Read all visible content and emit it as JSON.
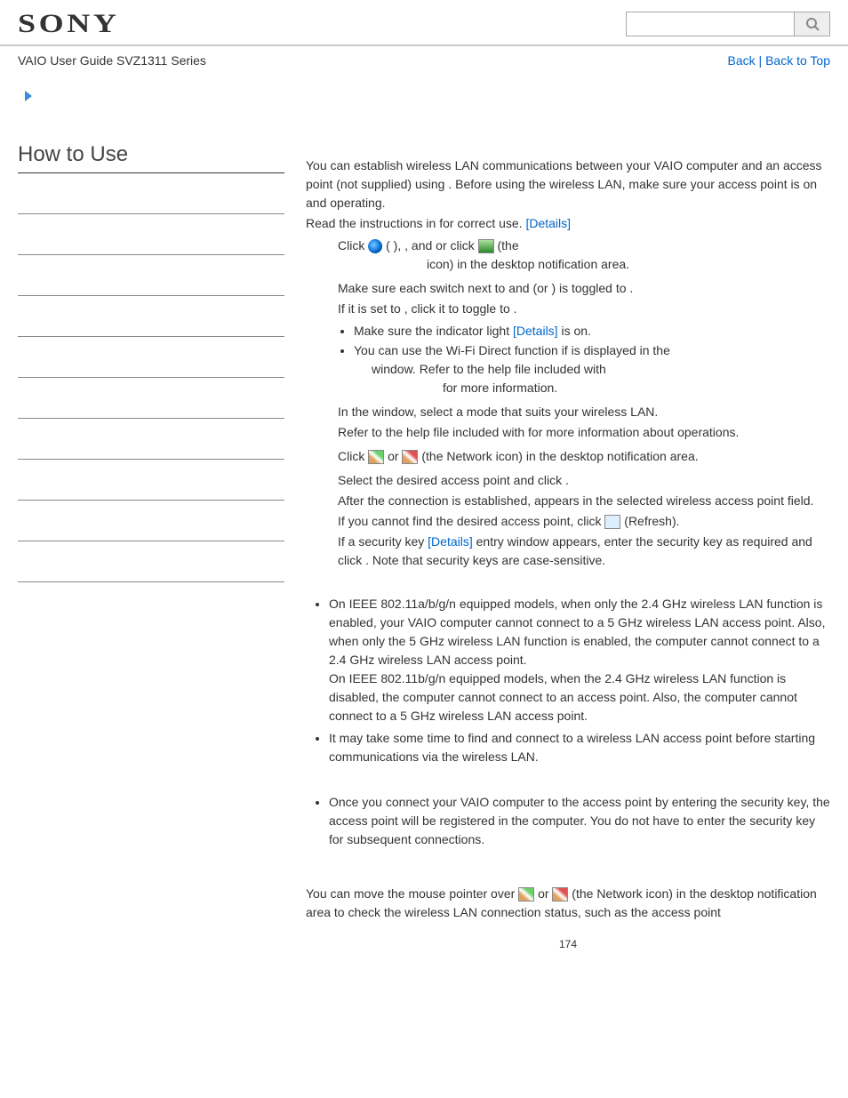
{
  "header": {
    "logo": "SONY",
    "subtitle": "VAIO User Guide SVZ1311 Series",
    "back": "Back",
    "back_to_top": "Back to Top",
    "sep": " | "
  },
  "sidebar": {
    "title": "How to Use"
  },
  "body": {
    "intro1a": "You can establish wireless LAN communications between your VAIO computer and an access point (not supplied) using ",
    "intro1b": ". Before using the wireless LAN, make sure your access point is on and operating.",
    "intro2a": "Read the instructions in ",
    "intro2b": " for correct use. ",
    "details": "[Details]",
    "s1a": "Click ",
    "s1b": " (      ), ",
    "s1c": ", and ",
    "s1d": " or click ",
    "s1e": " (the ",
    "s1f": " icon) in the desktop notification area.",
    "s2a": "Make sure each switch next to ",
    "s2b": " and ",
    "s2c": " (or          ) is toggled to      .",
    "s2d": "If it is set to      , click it to toggle to      .",
    "s2h1a": "Make sure the ",
    "s2h1b": " indicator light ",
    "s2h1c": " is on.",
    "s2h2a": "You can use the Wi-Fi Direct function if ",
    "s2h2b": " is displayed in the ",
    "s2h2c": " window. Refer to the help file included with ",
    "s2h2d": " for more information.",
    "s3a": "In the ",
    "s3b": " window, select a mode that suits your wireless LAN.",
    "s3c": "Refer to the help file included with ",
    "s3d": " for more information about operations.",
    "s4a": "Click ",
    "s4b": " or ",
    "s4c": " (the Network icon) in the desktop notification area.",
    "s5a": "Select the desired access point and click ",
    "s5b": ".",
    "s5c": "After the connection is established, ",
    "s5d": " appears in the selected wireless access point field.",
    "s5e": "If you cannot find the desired access point, click ",
    "s5f": " (Refresh).",
    "s5g": "If a security key ",
    "s5h": " entry window appears, enter the security key as required and click ",
    "s5i": ". Note that security keys are case-sensitive.",
    "note1": "On IEEE 802.11a/b/g/n equipped models, when only the 2.4 GHz wireless LAN function is enabled, your VAIO computer cannot connect to a 5 GHz wireless LAN access point. Also, when only the 5 GHz wireless LAN function is enabled, the computer cannot connect to a 2.4 GHz wireless LAN access point.",
    "note1b": "On IEEE 802.11b/g/n equipped models, when the 2.4 GHz wireless LAN function is disabled, the computer cannot connect to an access point. Also, the computer cannot connect to a 5 GHz wireless LAN access point.",
    "note2": "It may take some time to find and connect to a wireless LAN access point before starting communications via the wireless LAN.",
    "note3": "Once you connect your VAIO computer to the access point by entering the security key, the access point will be registered in the computer. You do not have to enter the security key for subsequent connections.",
    "status1": "You can move the mouse pointer over ",
    "status2": " or ",
    "status3": " (the Network icon) in the desktop notification area to check the wireless LAN connection status, such as the access point"
  },
  "page": "174"
}
